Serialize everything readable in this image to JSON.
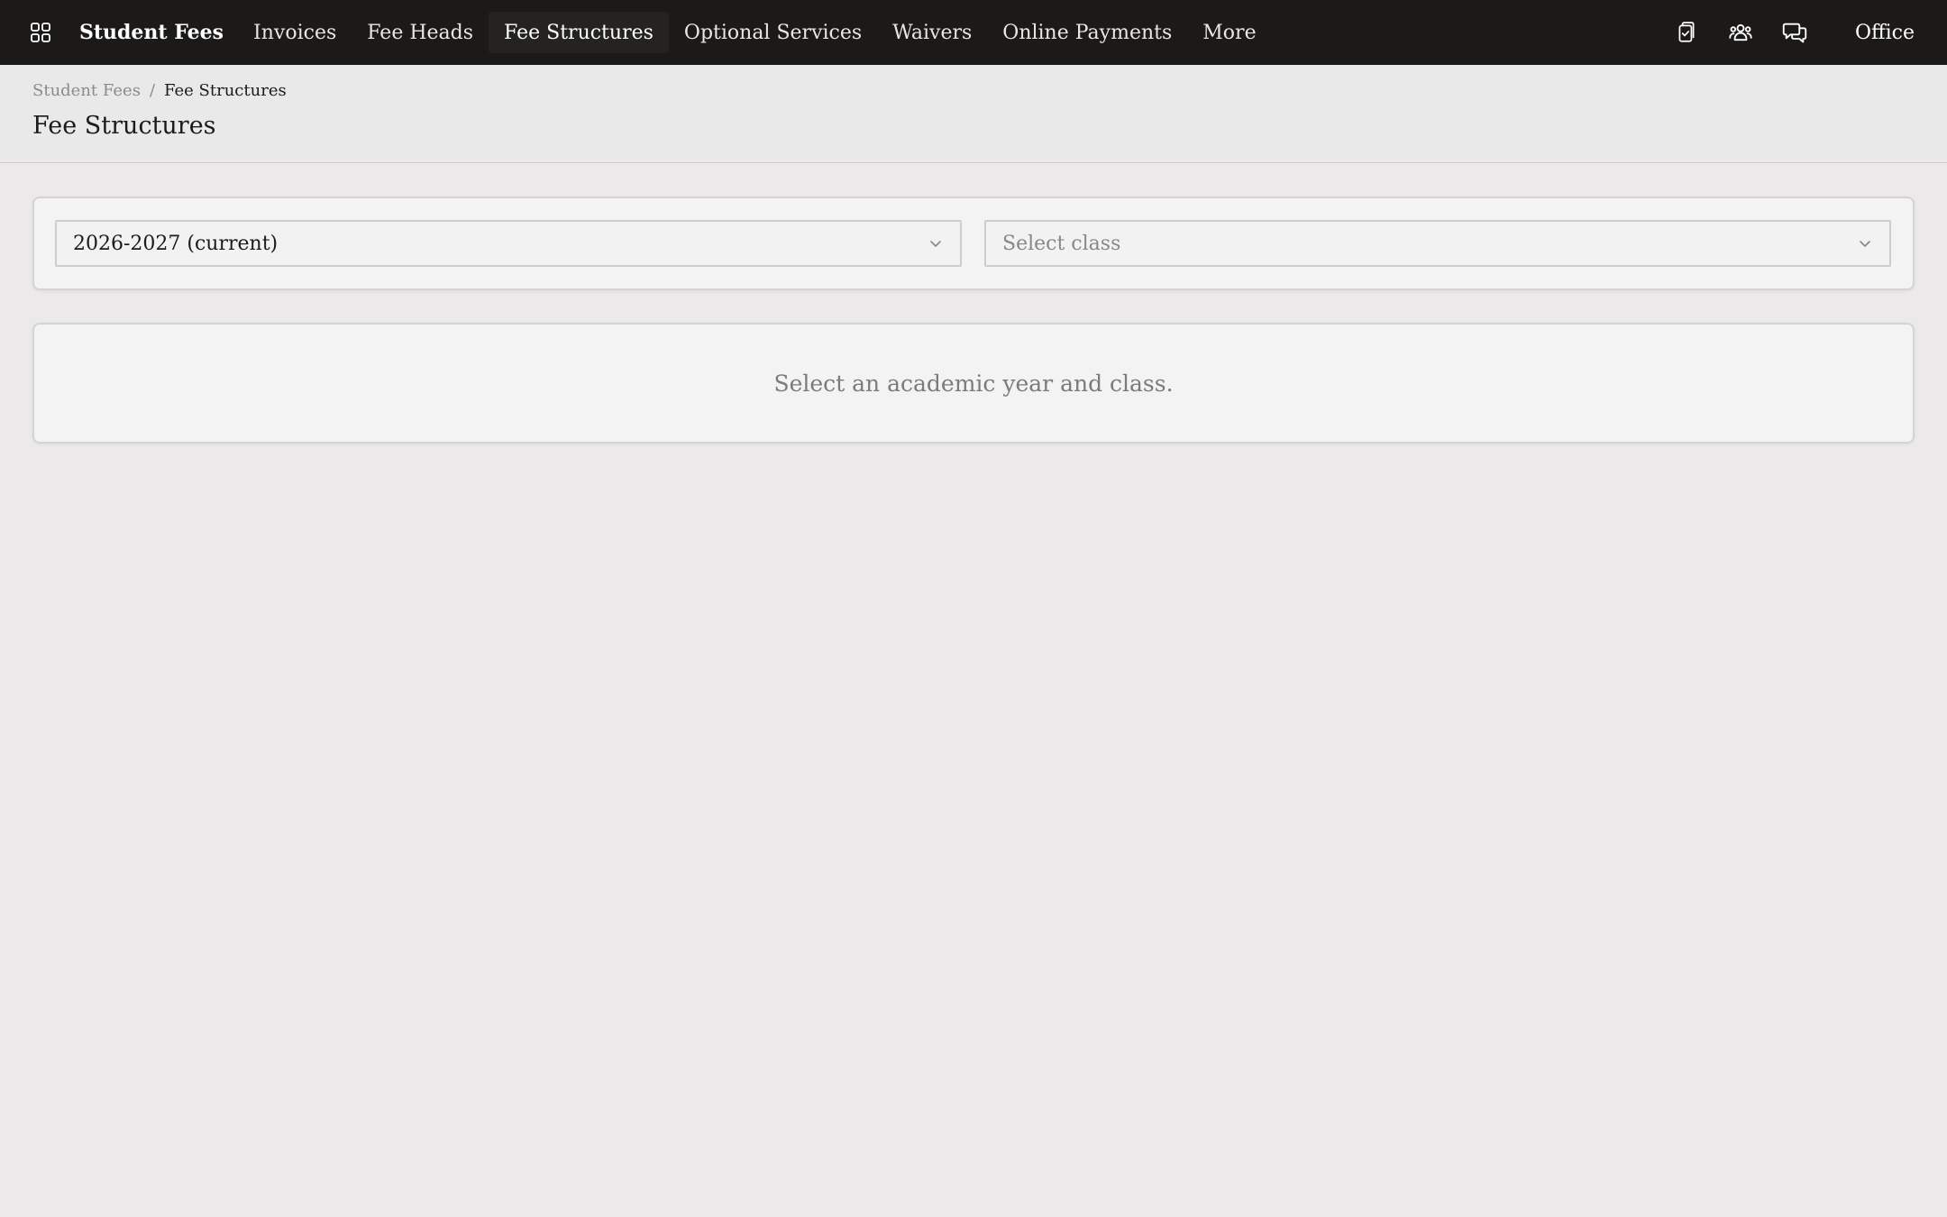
{
  "nav": {
    "brand": "Student Fees",
    "items": [
      {
        "label": "Invoices",
        "active": false
      },
      {
        "label": "Fee Heads",
        "active": false
      },
      {
        "label": "Fee Structures",
        "active": true
      },
      {
        "label": "Optional Services",
        "active": false
      },
      {
        "label": "Waivers",
        "active": false
      },
      {
        "label": "Online Payments",
        "active": false
      },
      {
        "label": "More",
        "active": false
      }
    ],
    "right_icons": [
      "clipboard-check-icon",
      "users-group-icon",
      "chat-bubbles-icon"
    ],
    "office_label": "Office"
  },
  "breadcrumb": {
    "parent": "Student Fees",
    "separator": "/",
    "current": "Fee Structures"
  },
  "page_title": "Fee Structures",
  "filters": {
    "academic_year": {
      "value": "2026-2027 (current)"
    },
    "class": {
      "placeholder": "Select class"
    }
  },
  "empty_state": {
    "message": "Select an academic year and class."
  },
  "colors": {
    "nav_bg": "#1b1a18",
    "page_bg": "#ebe9ea",
    "card_bg": "#f3f3f3"
  }
}
